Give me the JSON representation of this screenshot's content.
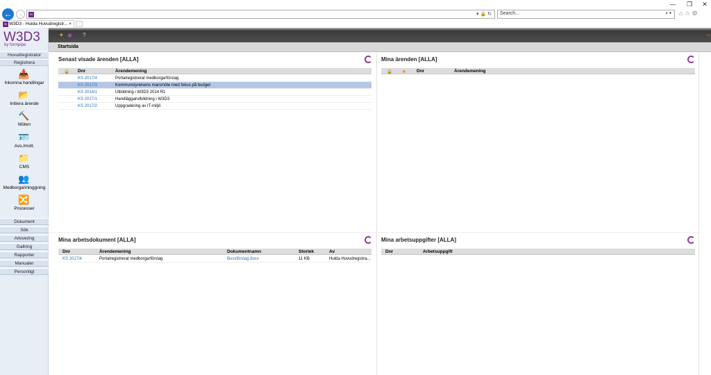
{
  "browser": {
    "search_placeholder": "Search...",
    "tab_title": "W3D3 - Hulda Huvudregistr...",
    "tab_close": "×",
    "minimize": "—",
    "restore": "❐",
    "close": "✕"
  },
  "sidebar": {
    "logo": "W3D3",
    "logo_sub": "by formpipe",
    "top_nav": [
      "Huvudregistrator",
      "Registrera"
    ],
    "tools": [
      {
        "label": "Inkomna handlingar",
        "icon": "inbox-icon"
      },
      {
        "label": "Initiera ärende",
        "icon": "folder-add-icon"
      },
      {
        "label": "Möten",
        "icon": "gavel-icon"
      },
      {
        "label": "Avs./mott.",
        "icon": "contact-card-icon"
      },
      {
        "label": "CMS",
        "icon": "cms-folder-icon"
      },
      {
        "label": "Medborgarinloggning",
        "icon": "citizen-login-icon"
      },
      {
        "label": "Processer",
        "icon": "process-icon"
      }
    ],
    "bottom_nav": [
      "Dokument",
      "Sök",
      "Arkivering",
      "Gallring",
      "Rapporter",
      "Manualer",
      "Personligt"
    ]
  },
  "header": {
    "title": "Startsida"
  },
  "panels": {
    "recent": {
      "title": "Senast visade ärenden [ALLA]",
      "columns": [
        "Dnr",
        "Ärendemening"
      ],
      "rows": [
        {
          "dnr": "KS 2017/4",
          "text": "Portalregistrerat medborgarförslag"
        },
        {
          "dnr": "KS 2017/3",
          "text": "Kommunstyrelsens marsmöte med fokus på budget"
        },
        {
          "dnr": "KS 2014/1",
          "text": "Utbildning i W3D3 2014 R1"
        },
        {
          "dnr": "KS 2017/1",
          "text": "Handläggarutbildning i W3D3"
        },
        {
          "dnr": "KS 2017/2",
          "text": "Uppgradering av IT-miljö"
        }
      ]
    },
    "my_cases": {
      "title": "Mina ärenden [ALLA]",
      "columns": [
        "Dnr",
        "Ärendemening"
      ]
    },
    "my_docs": {
      "title": "Mina arbetsdokument [ALLA]",
      "columns": [
        "Dnr",
        "Ärendemening",
        "Dokumentnamn",
        "Storlek",
        "Av"
      ],
      "rows": [
        {
          "dnr": "KS 2017/4",
          "text": "Portalregistrerat medborgarförslag",
          "doc": "Bussförslag.docx",
          "size": "11 KB",
          "by": "Hulda Huvudregistra..."
        }
      ]
    },
    "my_tasks": {
      "title": "Mina arbetsuppgifter [ALLA]",
      "columns": [
        "Dnr",
        "Arbetsuppgift"
      ]
    }
  },
  "colors": {
    "brand": "#7a2d88",
    "link": "#2a6fb7",
    "selected_row": "#b3c7e5"
  }
}
